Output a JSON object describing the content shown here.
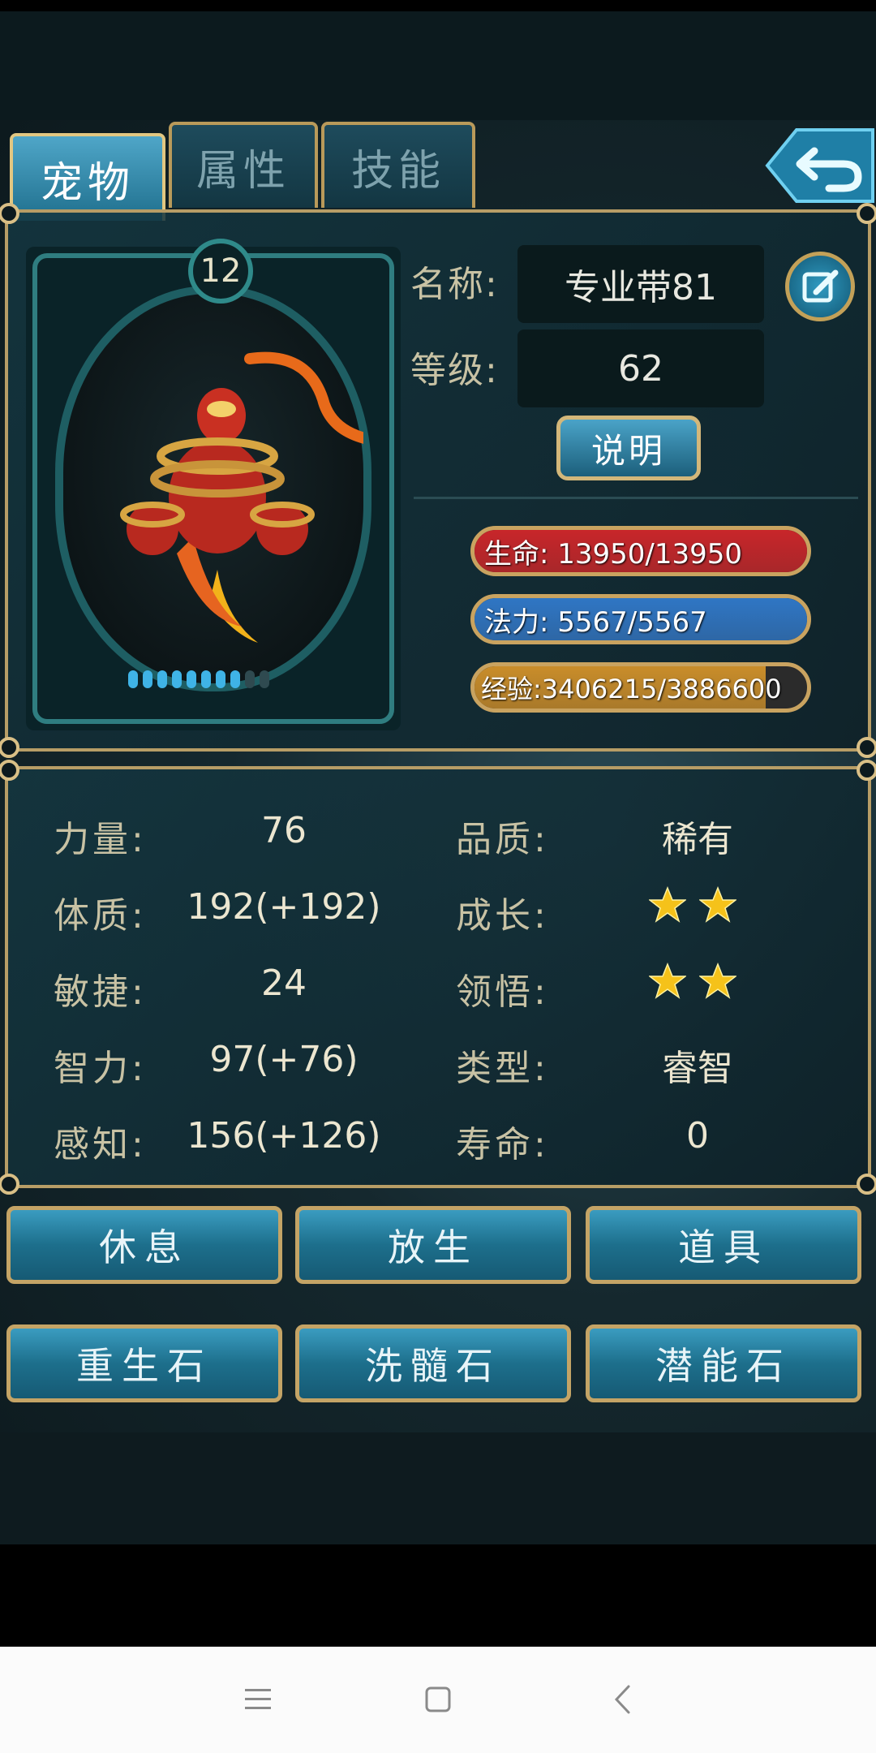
{
  "tabs": [
    {
      "label": "宠物",
      "active": true
    },
    {
      "label": "属性",
      "active": false
    },
    {
      "label": "技能",
      "active": false
    }
  ],
  "pet": {
    "level_badge": "12",
    "name_label": "名称:",
    "name_value": "专业带81",
    "grade_label": "等级:",
    "grade_value": "62",
    "desc_button": "说明",
    "dots_filled": 8,
    "dots_total": 10
  },
  "bars": [
    {
      "text": "生命: 13950/13950",
      "fill": 1.0,
      "color": "#c8262a"
    },
    {
      "text": "法力: 5567/5567",
      "fill": 1.0,
      "color": "#2f76c4"
    },
    {
      "text": "经验:3406215/3886600",
      "fill": 0.876,
      "color": "#c98d2a"
    }
  ],
  "stats_left": [
    {
      "label": "力量:",
      "value": "76"
    },
    {
      "label": "体质:",
      "value": "192(+192)"
    },
    {
      "label": "敏捷:",
      "value": "24"
    },
    {
      "label": "智力:",
      "value": "97(+76)"
    },
    {
      "label": "感知:",
      "value": "156(+126)"
    }
  ],
  "stats_right": [
    {
      "label": "品质:",
      "value": "稀有"
    },
    {
      "label": "成长:",
      "stars": 2
    },
    {
      "label": "领悟:",
      "stars": 2
    },
    {
      "label": "类型:",
      "value": "睿智"
    },
    {
      "label": "寿命:",
      "value": "0"
    }
  ],
  "buttons": [
    {
      "label": "休息"
    },
    {
      "label": "放生"
    },
    {
      "label": "道具"
    },
    {
      "label": "重生石"
    },
    {
      "label": "洗髓石"
    },
    {
      "label": "潜能石"
    }
  ],
  "colors": {
    "gold_border": "#b79d66",
    "star": "#f5c21a"
  }
}
